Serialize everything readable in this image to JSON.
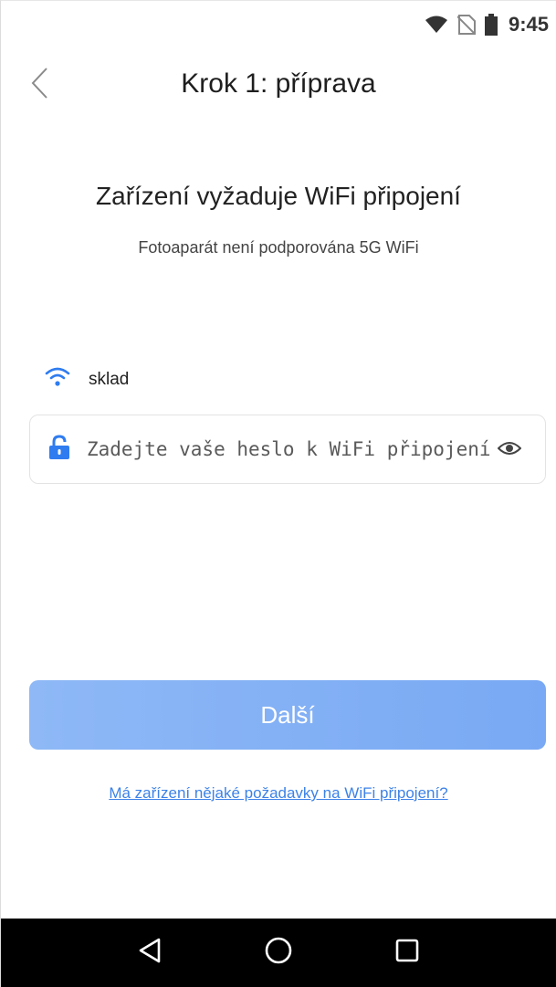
{
  "status_bar": {
    "time": "9:45",
    "icons": [
      "wifi-icon",
      "no-sim-icon",
      "battery-icon"
    ]
  },
  "header": {
    "back_icon": "chevron-left-icon",
    "title": "Krok 1: příprava"
  },
  "main": {
    "heading": "Zařízení vyžaduje WiFi připojení",
    "subheading": "Fotoaparát není podporována 5G WiFi",
    "network": {
      "icon": "wifi-icon",
      "ssid": "sklad"
    },
    "password": {
      "icon": "lock-icon",
      "value": "",
      "placeholder": "Zadejte vaše heslo k WiFi připojení",
      "toggle_icon": "eye-icon"
    },
    "next_button_label": "Další",
    "help_link": "Má zařízení nějaké požadavky na WiFi připojení?"
  },
  "nav_bar": {
    "buttons": [
      "back-triangle-icon",
      "home-circle-icon",
      "recents-square-icon"
    ]
  },
  "colors": {
    "accent": "#3c82e8",
    "button": "#8eb8f6",
    "wifi": "#2f7cf0",
    "lock": "#2f7cf0"
  }
}
